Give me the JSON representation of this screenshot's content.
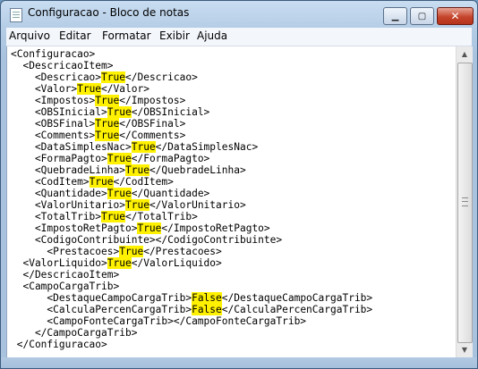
{
  "window": {
    "title": "Configuracao - Bloco de notas",
    "controls": {
      "minimize_icon": "minimize-icon",
      "maximize_icon": "maximize-icon",
      "close_icon": "close-icon"
    }
  },
  "menu": {
    "items": [
      "Arquivo",
      "Editar",
      "Formatar",
      "Exibir",
      "Ajuda"
    ]
  },
  "content": {
    "highlight_color": "#fff100",
    "lines": [
      [
        {
          "t": "<Configuracao>"
        }
      ],
      [
        {
          "t": "  <DescricaoItem>"
        }
      ],
      [
        {
          "t": "    <Descricao>"
        },
        {
          "t": "True",
          "hl": true
        },
        {
          "t": "</Descricao>"
        }
      ],
      [
        {
          "t": "    <Valor>"
        },
        {
          "t": "True",
          "hl": true
        },
        {
          "t": "</Valor>"
        }
      ],
      [
        {
          "t": "    <Impostos>"
        },
        {
          "t": "True",
          "hl": true
        },
        {
          "t": "</Impostos>"
        }
      ],
      [
        {
          "t": "    <OBSInicial>"
        },
        {
          "t": "True",
          "hl": true
        },
        {
          "t": "</OBSInicial>"
        }
      ],
      [
        {
          "t": "    <OBSFinal>"
        },
        {
          "t": "True",
          "hl": true
        },
        {
          "t": "</OBSFinal>"
        }
      ],
      [
        {
          "t": "    <Comments>"
        },
        {
          "t": "True",
          "hl": true
        },
        {
          "t": "</Comments>"
        }
      ],
      [
        {
          "t": "    <DataSimplesNac>"
        },
        {
          "t": "True",
          "hl": true
        },
        {
          "t": "</DataSimplesNac>"
        }
      ],
      [
        {
          "t": "    <FormaPagto>"
        },
        {
          "t": "True",
          "hl": true
        },
        {
          "t": "</FormaPagto>"
        }
      ],
      [
        {
          "t": "    <QuebradeLinha>"
        },
        {
          "t": "True",
          "hl": true
        },
        {
          "t": "</QuebradeLinha>"
        }
      ],
      [
        {
          "t": "    <CodItem>"
        },
        {
          "t": "True",
          "hl": true
        },
        {
          "t": "</CodItem>"
        }
      ],
      [
        {
          "t": "    <Quantidade>"
        },
        {
          "t": "True",
          "hl": true
        },
        {
          "t": "</Quantidade>"
        }
      ],
      [
        {
          "t": "    <ValorUnitario>"
        },
        {
          "t": "True",
          "hl": true
        },
        {
          "t": "</ValorUnitario>"
        }
      ],
      [
        {
          "t": "    <TotalTrib>"
        },
        {
          "t": "True",
          "hl": true
        },
        {
          "t": "</TotalTrib>"
        }
      ],
      [
        {
          "t": "    <ImpostoRetPagto>"
        },
        {
          "t": "True",
          "hl": true
        },
        {
          "t": "</ImpostoRetPagto>"
        }
      ],
      [
        {
          "t": "    <CodigoContribuinte></CodigoContribuinte>"
        }
      ],
      [
        {
          "t": "      <Prestacoes>"
        },
        {
          "t": "True",
          "hl": true
        },
        {
          "t": "</Prestacoes>"
        }
      ],
      [
        {
          "t": "  <ValorLiquido>"
        },
        {
          "t": "True",
          "hl": true
        },
        {
          "t": "</ValorLiquido>"
        }
      ],
      [
        {
          "t": "  </DescricaoItem>"
        }
      ],
      [
        {
          "t": "  <CampoCargaTrib>"
        }
      ],
      [
        {
          "t": "      <DestaqueCampoCargaTrib>"
        },
        {
          "t": "False",
          "hl": true
        },
        {
          "t": "</DestaqueCampoCargaTrib>"
        }
      ],
      [
        {
          "t": "      <CalculaPercenCargaTrib>"
        },
        {
          "t": "False",
          "hl": true
        },
        {
          "t": "</CalculaPercenCargaTrib>"
        }
      ],
      [
        {
          "t": "      <CampoFonteCargaTrib></CampoFonteCargaTrib>"
        }
      ],
      [
        {
          "t": "    </CampoCargaTrib>"
        }
      ],
      [
        {
          "t": " </Configuracao>"
        }
      ]
    ]
  }
}
